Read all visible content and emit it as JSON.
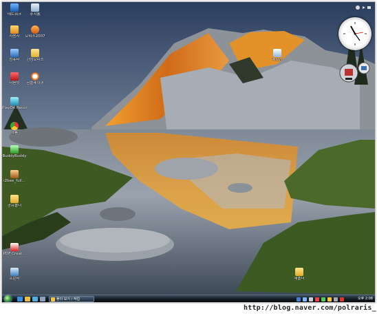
{
  "desktop_icons": [
    {
      "label": "네트워크",
      "icon": "network-icon"
    },
    {
      "label": "휴지통",
      "icon": "recycle-bin-icon"
    },
    {
      "label": "사용자",
      "icon": "user-folder-icon"
    },
    {
      "label": "오피스2007",
      "icon": "office-icon"
    },
    {
      "label": "컴퓨터",
      "icon": "computer-icon"
    },
    {
      "label": "한컴오피스",
      "icon": "hancom-icon"
    },
    {
      "label": "다음팟",
      "icon": "daumpot-icon"
    },
    {
      "label": "곰플레이어",
      "icon": "gomplayer-icon"
    },
    {
      "label": "PlayOn Recorder",
      "icon": "playon-icon"
    },
    {
      "label": "크롬",
      "icon": "chrome-icon"
    },
    {
      "label": "BuddyBuddy",
      "icon": "buddybuddy-icon"
    },
    {
      "label": "i2bee_full...",
      "icon": "i2bee-icon"
    },
    {
      "label": "공유폴더",
      "icon": "folder-icon"
    },
    {
      "label": "PDF Creat...",
      "icon": "pdf-icon"
    },
    {
      "label": "프린터",
      "icon": "printer-icon"
    },
    {
      "label": "새폴더",
      "icon": "folder-icon"
    },
    {
      "label": "메모장",
      "icon": "notepad-icon"
    }
  ],
  "taskbar": {
    "task_button_label": "폴더 보기 / 작업",
    "quick_launch": [
      "ie-icon",
      "folder-icon",
      "media-icon",
      "show-desktop-icon"
    ],
    "clock": "오후 2:08"
  },
  "colors": {
    "taskbar": "#10181f",
    "start_orb": "#3fa23a",
    "mountain_lit": "#e58a1f"
  },
  "watermark": "http://blog.naver.com/polraris_"
}
